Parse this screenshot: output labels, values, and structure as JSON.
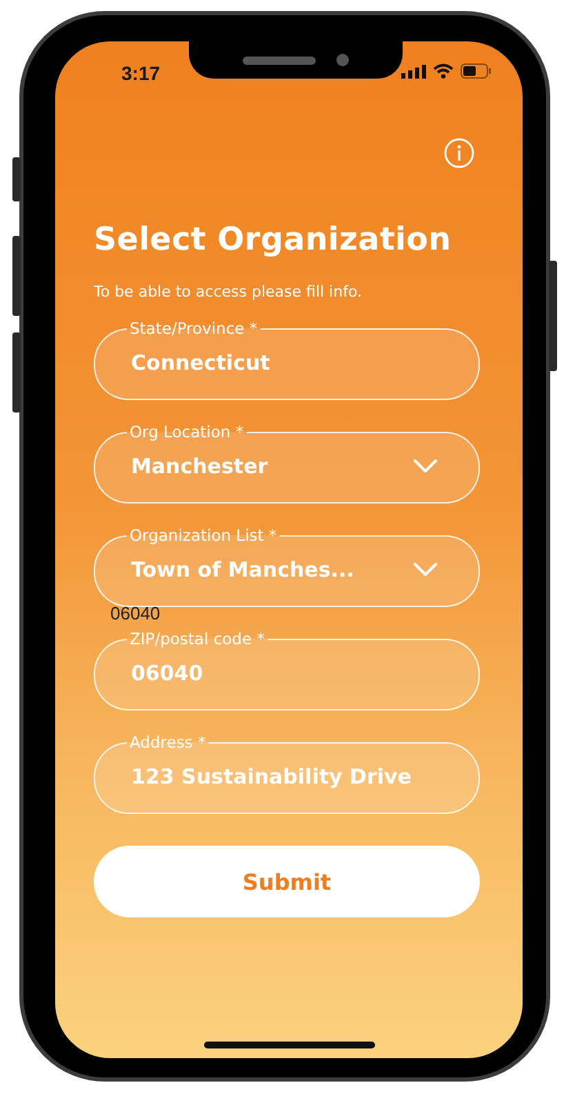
{
  "status_bar": {
    "time": "3:17"
  },
  "title": "Select Organization",
  "subtitle": "To be able to access please fill info.",
  "fields": [
    {
      "kind": "text",
      "label": "State/Province *",
      "value": "Connecticut"
    },
    {
      "kind": "dropdown",
      "label": "Org Location *",
      "value": "Manchester"
    },
    {
      "kind": "dropdown",
      "label": "Organization List *",
      "value": "Town of Manches..."
    },
    {
      "kind": "text",
      "label": "ZIP/postal code *",
      "value": "06040",
      "note": "06040"
    },
    {
      "kind": "text",
      "label": "Address *",
      "value": "123 Sustainability Drive"
    }
  ],
  "submit_button": "Submit"
}
